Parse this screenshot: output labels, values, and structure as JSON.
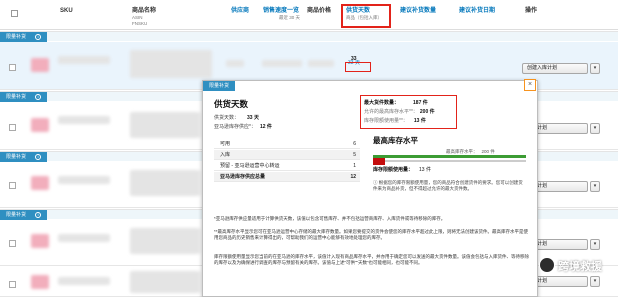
{
  "header": {
    "sku": "SKU",
    "product_name": "商品名称",
    "asin": "ASIN",
    "fnsku": "FNSKU",
    "supply_qty": "供应商",
    "sales_velocity": "销售速度一览",
    "sales_sub": "最近 30 天",
    "product_price": "商品价格",
    "days_of_supply": "供货天数",
    "days_sub": "商品（包括入库）",
    "restock_qty": "建议补货数量",
    "restock_date": "建议补货日期",
    "actions": "操作"
  },
  "group_label": "限量补货",
  "rows": [
    {
      "days_num": "33",
      "days_value": "33 天",
      "plan_label": "创建入库计划"
    },
    {
      "plan_label": "入库计划"
    },
    {
      "plan_label": "入库计划"
    },
    {
      "plan_label": "入库计划"
    },
    {
      "plan_label": "入库计划"
    }
  ],
  "popup": {
    "tag": "限量补货",
    "close": "×",
    "title": "供货天数",
    "supply_days_label": "供货天数：",
    "supply_days_value": "33 天",
    "amazon_stock_label": "亚马逊库存供应*：",
    "amazon_stock_value": "12 件",
    "list": [
      {
        "k": "可用",
        "v": "6"
      },
      {
        "k": "入库",
        "v": "5"
      },
      {
        "k": "预留 - 亚马逊运营中心转运",
        "v": "1"
      },
      {
        "k": "亚马逊库存供应总量",
        "v": "12"
      }
    ],
    "max_ship_label": "最大货件数量：",
    "max_ship_value": "187 件",
    "max_storage_label": "允许的最高库存水平**：",
    "max_storage_value": "200 件",
    "used_label": "库存限额使用量**：",
    "used_value": "13 件",
    "max_level_title": "最高库存水平",
    "bar_label": "最高库存水平：",
    "bar_value": "200 件",
    "usage_label": "库存限额使用量：",
    "usage_value": "13 件",
    "note": "根据您的库存限额使用量，您的商品符合创建货件的要求。您可以创建货件来为商品补货，但不得超过允许的最大货件数。",
    "footnote1": "*亚马逊库存供应量适用于计算供货天数，该值以包含可售库存、并不包括运营商库存、入库货件或等待移除的库存。",
    "footnote2": "**最高库存水平显示您可在亚马逊运营中心存储的最大库存数量。如果您要提交的货件会使您的库存水平超过此上限，则将无法创建该货件。最高库存水平是使用您商品的历史销售来计算得出的，可帮助我们的运营中心能够有效地处理您的库存。",
    "footnote3": "库存限额使用量显示您当前的在亚马逊的库存水平，该值计入现有商品库存水平，并亦用于确定您可以发送的最大货件数量。该值会包括与入库货件、等待移除的库存以及为确保进行调查的库存与预留有关的库存。该值与上述“可供”“天数”也可能相同，也可能不同。"
  },
  "watermark": "跨境救援"
}
